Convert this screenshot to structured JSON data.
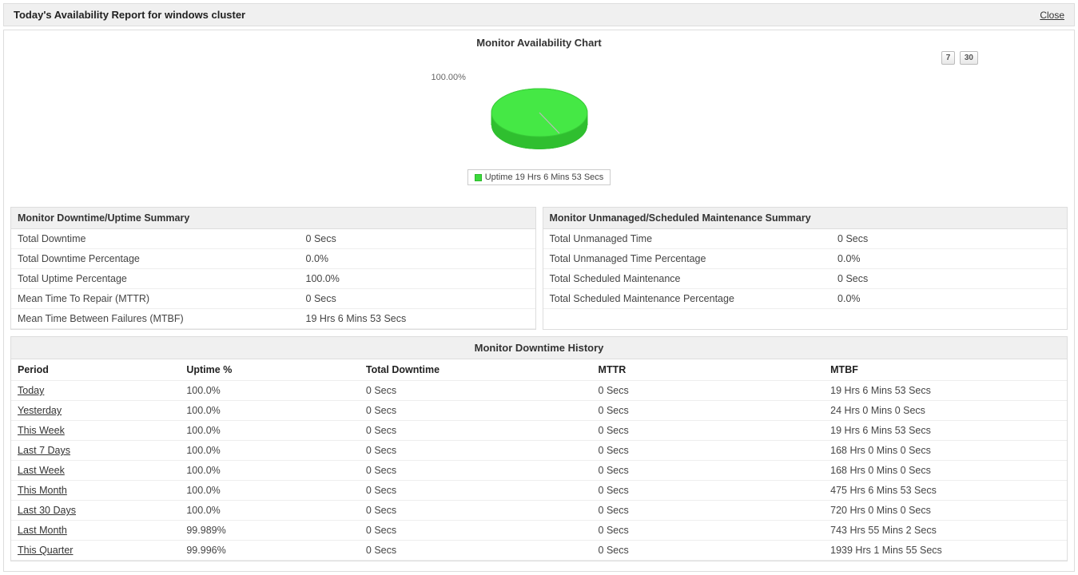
{
  "header": {
    "title": "Today's Availability Report for windows cluster",
    "close": "Close"
  },
  "chart": {
    "title": "Monitor Availability Chart",
    "btn7": "7",
    "btn30": "30",
    "slice_label": "100.00%",
    "legend": "Uptime 19 Hrs 6 Mins 53 Secs"
  },
  "chart_data": {
    "type": "pie",
    "title": "Monitor Availability Chart",
    "series": [
      {
        "name": "Uptime 19 Hrs 6 Mins 53 Secs",
        "value": 100.0,
        "color": "#3cd93c"
      }
    ]
  },
  "summary_left": {
    "title": "Monitor Downtime/Uptime Summary",
    "rows": [
      {
        "label": "Total Downtime",
        "value": "0 Secs"
      },
      {
        "label": "Total Downtime Percentage",
        "value": "0.0%"
      },
      {
        "label": "Total Uptime Percentage",
        "value": "100.0%"
      },
      {
        "label": "Mean Time To Repair (MTTR)",
        "value": "0 Secs"
      },
      {
        "label": "Mean Time Between Failures (MTBF)",
        "value": "19 Hrs 6 Mins 53 Secs"
      }
    ]
  },
  "summary_right": {
    "title": "Monitor Unmanaged/Scheduled Maintenance Summary",
    "rows": [
      {
        "label": "Total Unmanaged Time",
        "value": "0 Secs"
      },
      {
        "label": "Total Unmanaged Time Percentage",
        "value": "0.0%"
      },
      {
        "label": "Total Scheduled Maintenance",
        "value": "0 Secs"
      },
      {
        "label": "Total Scheduled Maintenance Percentage",
        "value": "0.0%"
      }
    ]
  },
  "history": {
    "title": "Monitor Downtime History",
    "columns": [
      "Period",
      "Uptime %",
      "Total Downtime",
      "MTTR",
      "MTBF"
    ],
    "rows": [
      {
        "period": "Today",
        "uptime": "100.0%",
        "downtime": "0 Secs",
        "mttr": "0 Secs",
        "mtbf": "19 Hrs 6 Mins 53 Secs"
      },
      {
        "period": "Yesterday",
        "uptime": "100.0%",
        "downtime": "0 Secs",
        "mttr": "0 Secs",
        "mtbf": "24 Hrs 0 Mins 0 Secs"
      },
      {
        "period": "This Week",
        "uptime": "100.0%",
        "downtime": "0 Secs",
        "mttr": "0 Secs",
        "mtbf": "19 Hrs 6 Mins 53 Secs"
      },
      {
        "period": "Last 7 Days",
        "uptime": "100.0%",
        "downtime": "0 Secs",
        "mttr": "0 Secs",
        "mtbf": "168 Hrs 0 Mins 0 Secs"
      },
      {
        "period": "Last Week",
        "uptime": "100.0%",
        "downtime": "0 Secs",
        "mttr": "0 Secs",
        "mtbf": "168 Hrs 0 Mins 0 Secs"
      },
      {
        "period": "This Month",
        "uptime": "100.0%",
        "downtime": "0 Secs",
        "mttr": "0 Secs",
        "mtbf": "475 Hrs 6 Mins 53 Secs"
      },
      {
        "period": "Last 30 Days",
        "uptime": "100.0%",
        "downtime": "0 Secs",
        "mttr": "0 Secs",
        "mtbf": "720 Hrs 0 Mins 0 Secs"
      },
      {
        "period": "Last Month",
        "uptime": "99.989%",
        "downtime": "0 Secs",
        "mttr": "0 Secs",
        "mtbf": "743 Hrs 55 Mins 2 Secs"
      },
      {
        "period": "This Quarter",
        "uptime": "99.996%",
        "downtime": "0 Secs",
        "mttr": "0 Secs",
        "mtbf": "1939 Hrs 1 Mins 55 Secs"
      }
    ]
  }
}
